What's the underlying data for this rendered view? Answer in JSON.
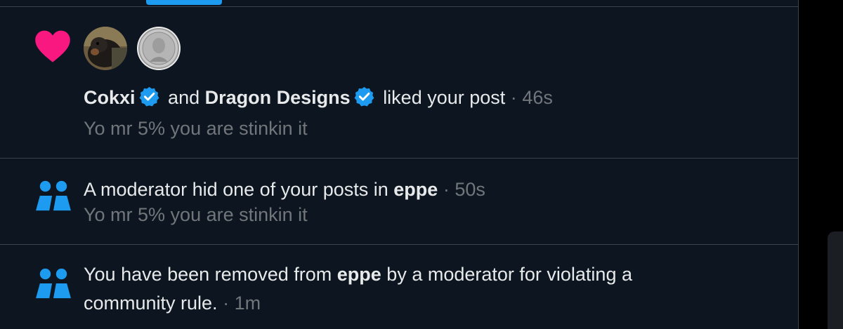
{
  "notifications": [
    {
      "type": "like",
      "user1": "Cokxi",
      "connector": "and",
      "user2": "Dragon Designs",
      "action": "liked your post",
      "separator": "·",
      "time": "46s",
      "snippet": "Yo mr 5% you are stinkin it",
      "icon": "heart-icon"
    },
    {
      "type": "community",
      "text_before": "A moderator hid one of your posts in",
      "community": "eppe",
      "separator": "·",
      "time": "50s",
      "snippet": "Yo mr 5% you are stinkin it",
      "icon": "community-icon"
    },
    {
      "type": "community",
      "text_before": "You have been removed from",
      "community": "eppe",
      "text_after": "by a moderator for violating a",
      "text_line2": "community rule.",
      "separator": "·",
      "time": "1m",
      "icon": "community-icon"
    }
  ],
  "colors": {
    "background": "#0d1620",
    "divider": "#38444d",
    "text": "#e7e9ea",
    "muted": "#71767b",
    "accent": "#1d9bf0",
    "heart": "#f91880"
  }
}
